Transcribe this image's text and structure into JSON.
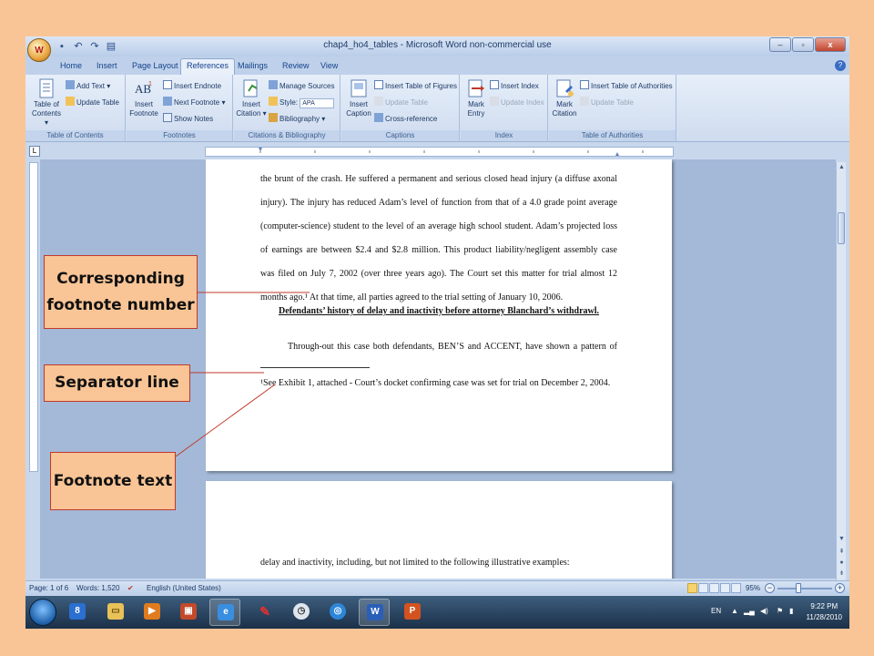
{
  "titlebar": {
    "title": "chap4_ho4_tables - Microsoft Word non-commercial use",
    "office_button": "W",
    "minimize": "–",
    "maximize": "▫",
    "close": "x"
  },
  "tabs": [
    {
      "label": "Home"
    },
    {
      "label": "Insert"
    },
    {
      "label": "Page Layout"
    },
    {
      "label": "References",
      "active": true
    },
    {
      "label": "Mailings"
    },
    {
      "label": "Review"
    },
    {
      "label": "View"
    }
  ],
  "ribbon": {
    "toc": {
      "group_label": "Table of Contents",
      "table_of_contents": "Table of Contents ▾",
      "add_text": "Add Text ▾",
      "update_table": "Update Table"
    },
    "footnotes": {
      "group_label": "Footnotes",
      "insert_footnote": "Insert Footnote",
      "insert_endnote": "Insert Endnote",
      "next_footnote": "Next Footnote ▾",
      "show_notes": "Show Notes"
    },
    "citations": {
      "group_label": "Citations & Bibliography",
      "insert_citation": "Insert Citation ▾",
      "manage_sources": "Manage Sources",
      "style_label": "Style:",
      "style_value": "APA",
      "bibliography": "Bibliography ▾"
    },
    "captions": {
      "group_label": "Captions",
      "insert_caption": "Insert Caption",
      "insert_table_of_figures": "Insert Table of Figures",
      "update_table": "Update Table",
      "cross_reference": "Cross-reference"
    },
    "index": {
      "group_label": "Index",
      "mark_entry": "Mark Entry",
      "insert_index": "Insert Index",
      "update_index": "Update Index"
    },
    "authorities": {
      "group_label": "Table of Authorities",
      "mark_citation": "Mark Citation",
      "insert_table_of_authorities": "Insert Table of Authorities",
      "update_table": "Update Table"
    }
  },
  "document": {
    "page1_lines": [
      "the brunt of the crash.   He suffered a permanent and serious closed head injury (a diffuse axonal",
      "injury).   The injury has reduced Adam’s level of function from that of a 4.0 grade point average",
      "(computer-science) student to the level of an average high school student.   Adam’s projected loss",
      "of earnings are between $2.4 and $2.8 million.   This product liability/negligent assembly case",
      "was filed on July 7, 2002 (over three years ago).   The Court set this matter for trial almost 12",
      "months ago.¹   At that time, all parties agreed to the trial setting of January 10, 2006."
    ],
    "heading": "Defendants’ history of delay and inactivity before attorney Blanchard’s withdrawl.",
    "paragraph_start": "Through-out this case both defendants, BEN’S and ACCENT, have shown a pattern of",
    "footnote_text": "¹See Exhibit 1, attached - Court’s docket confirming case was set for trial on December 2, 2004.",
    "page2_lines": [
      "delay and inactivity, including, but not limited to the following illustrative examples:"
    ]
  },
  "statusbar": {
    "page": "Page: 1 of 6",
    "words": "Words: 1,520",
    "language": "English (United States)",
    "zoom": "95%",
    "zoom_minus": "−",
    "zoom_plus": "+"
  },
  "taskbar": {
    "language": "EN",
    "time": "9:22 PM",
    "date": "11/28/2010"
  },
  "callouts": {
    "footnote_number": "Corresponding footnote number",
    "separator_line": "Separator line",
    "footnote_text": "Footnote text"
  },
  "colors": {
    "slide_background": "#f9c596",
    "callout_border": "#c0392b",
    "ribbon_blue": "#15428b"
  }
}
